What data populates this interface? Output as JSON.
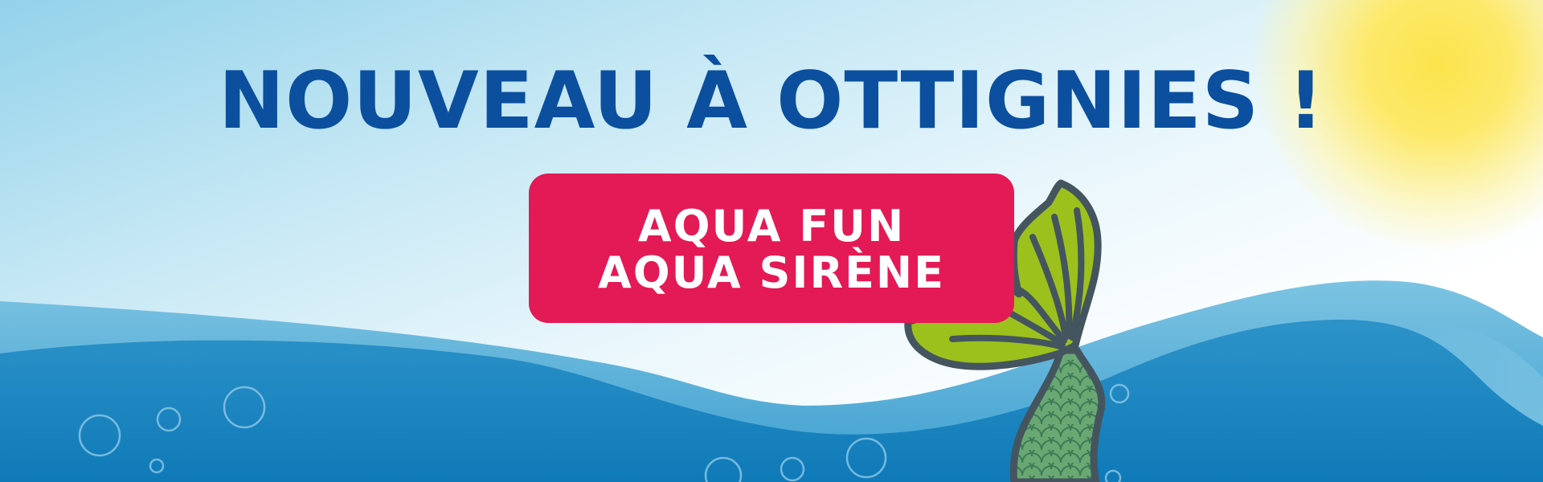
{
  "banner": {
    "headline": "NOUVEAU À OTTIGNIES !",
    "cta": {
      "line1": "AQUA FUN",
      "line2": "AQUA SIRÈNE"
    }
  },
  "colors": {
    "headline": "#0b4f9e",
    "cta_background": "#e31a55",
    "cta_text": "#ffffff",
    "sea_light": "#5fb3d9",
    "sea_deep": "#1c86c2",
    "sun": "#fbe44c",
    "fin_green": "#9cc11c",
    "tail_scales": "#6faa72",
    "tail_outline": "#445560"
  },
  "icons": [
    "sun",
    "waves",
    "bubbles",
    "mermaid-tail"
  ]
}
